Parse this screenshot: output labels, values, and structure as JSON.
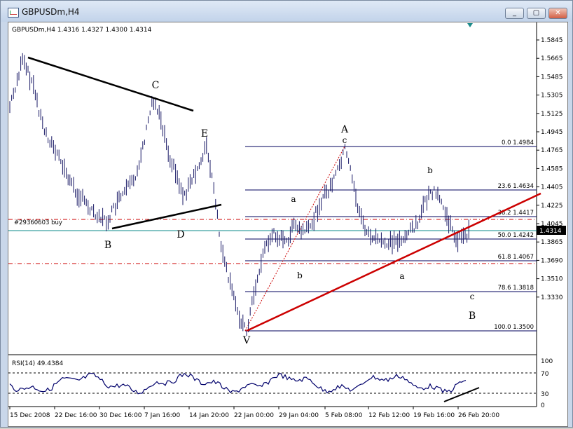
{
  "window": {
    "title": "GBPUSDm,H4"
  },
  "window_buttons": {
    "minimize": "_",
    "maximize": "▢",
    "close": "✕"
  },
  "chart": {
    "header": "GBPUSDm,H4  1.4316 1.4327 1.4300 1.4314",
    "price_axis": [
      "1.5845",
      "1.5665",
      "1.5485",
      "1.5305",
      "1.5125",
      "1.4945",
      "1.4765",
      "1.4585",
      "1.4405",
      "1.4225",
      "1.4045",
      "1.3865",
      "1.3690",
      "1.3510",
      "1.3330"
    ],
    "current_price": "1.4314",
    "time_axis": [
      "15 Dec 2008",
      "22 Dec 16:00",
      "30 Dec 16:00",
      "7 Jan 16:00",
      "14 Jan 20:00",
      "22 Jan 00:00",
      "29 Jan 04:00",
      "5 Feb 08:00",
      "12 Feb 12:00",
      "19 Feb 16:00",
      "26 Feb 20:00"
    ],
    "order_label": "#29360603 buy",
    "fib_levels": [
      {
        "label": "0.0 1.4984"
      },
      {
        "label": "23.6 1.4634"
      },
      {
        "label": "38.2 1.4417"
      },
      {
        "label": "50.0 1.4242"
      },
      {
        "label": "61.8 1.4067"
      },
      {
        "label": "78.6 1.3818"
      },
      {
        "label": "100.0 1.3500"
      }
    ],
    "wave_labels": {
      "C": "C",
      "E": "E",
      "B": "B",
      "D": "D",
      "A": "A",
      "c_top": "c",
      "a1": "a",
      "b1": "b",
      "b2": "b",
      "a2": "a",
      "c2": "c",
      "B2": "B",
      "V": "V"
    }
  },
  "rsi": {
    "label": "RSI(14) 49.4384",
    "axis": [
      "100",
      "70",
      "30",
      "0"
    ]
  },
  "colors": {
    "bars": "#1a1a66",
    "trend": "#cc0000",
    "fib": "#00005c",
    "rsi": "#00006b",
    "current": "#0a8a8a"
  }
}
